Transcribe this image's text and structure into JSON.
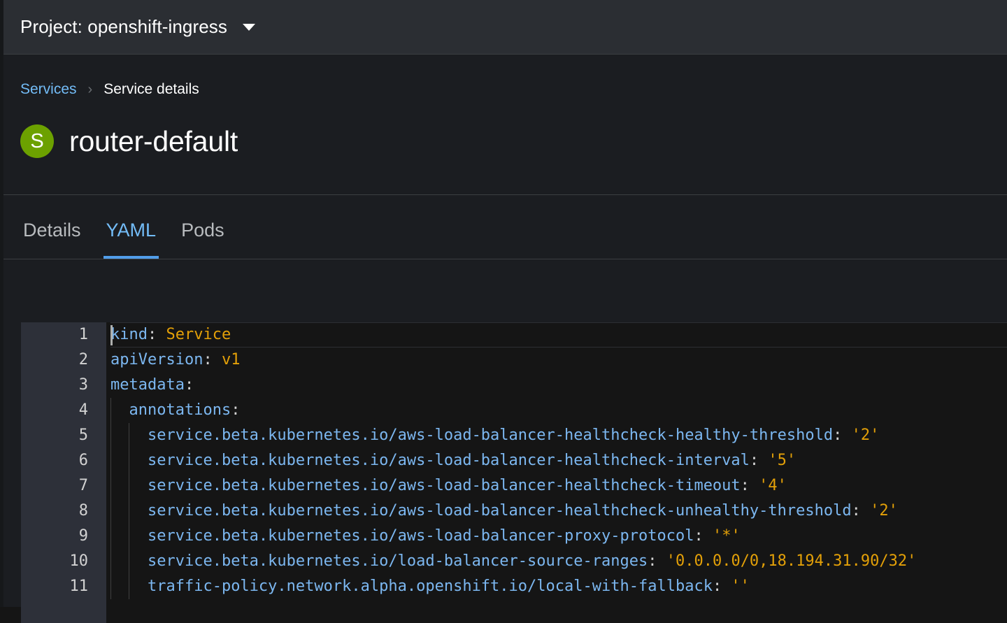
{
  "project_bar": {
    "label": "Project: openshift-ingress",
    "caret_icon": "chevron-down-icon"
  },
  "breadcrumb": {
    "parent": "Services",
    "separator": "›",
    "current": "Service details"
  },
  "resource": {
    "badge_letter": "S",
    "badge_color": "#6ca100",
    "name": "router-default"
  },
  "tabs": [
    {
      "label": "Details",
      "active": false
    },
    {
      "label": "YAML",
      "active": true
    },
    {
      "label": "Pods",
      "active": false
    }
  ],
  "accent_color": "#519de9",
  "link_color": "#73bcf7",
  "editor": {
    "language": "yaml",
    "cursor_line": 1,
    "cursor_column": 1,
    "lines": [
      {
        "num": "1",
        "indent": 0,
        "key": "kind",
        "colon": ":",
        "value": " Service",
        "quoted": false
      },
      {
        "num": "2",
        "indent": 0,
        "key": "apiVersion",
        "colon": ":",
        "value": " v1",
        "quoted": false
      },
      {
        "num": "3",
        "indent": 0,
        "key": "metadata",
        "colon": ":",
        "value": "",
        "quoted": false
      },
      {
        "num": "4",
        "indent": 2,
        "key": "annotations",
        "colon": ":",
        "value": "",
        "quoted": false
      },
      {
        "num": "5",
        "indent": 4,
        "key": "service.beta.kubernetes.io/aws-load-balancer-healthcheck-healthy-threshold",
        "colon": ":",
        "value": " '2'",
        "quoted": true
      },
      {
        "num": "6",
        "indent": 4,
        "key": "service.beta.kubernetes.io/aws-load-balancer-healthcheck-interval",
        "colon": ":",
        "value": " '5'",
        "quoted": true
      },
      {
        "num": "7",
        "indent": 4,
        "key": "service.beta.kubernetes.io/aws-load-balancer-healthcheck-timeout",
        "colon": ":",
        "value": " '4'",
        "quoted": true
      },
      {
        "num": "8",
        "indent": 4,
        "key": "service.beta.kubernetes.io/aws-load-balancer-healthcheck-unhealthy-threshold",
        "colon": ":",
        "value": " '2'",
        "quoted": true
      },
      {
        "num": "9",
        "indent": 4,
        "key": "service.beta.kubernetes.io/aws-load-balancer-proxy-protocol",
        "colon": ":",
        "value": " '*'",
        "quoted": true
      },
      {
        "num": "10",
        "indent": 4,
        "key": "service.beta.kubernetes.io/load-balancer-source-ranges",
        "colon": ":",
        "value": " '0.0.0.0/0,18.194.31.90/32'",
        "quoted": true
      },
      {
        "num": "11",
        "indent": 4,
        "key": "traffic-policy.network.alpha.openshift.io/local-with-fallback",
        "colon": ":",
        "value": " ''",
        "quoted": true
      }
    ]
  }
}
